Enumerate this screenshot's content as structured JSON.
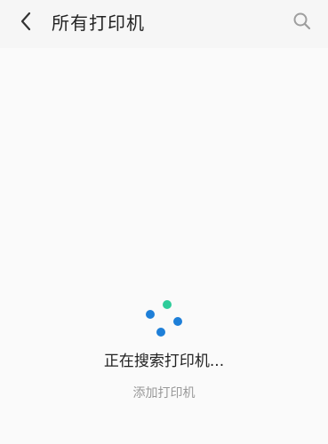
{
  "header": {
    "back_icon": "chevron-left-icon",
    "title": "所有打印机",
    "search_icon": "search-icon"
  },
  "main": {
    "status_text": "正在搜索打印机...",
    "add_printer_label": "添加打印机",
    "spinner": {
      "icon": "loading-spinner-icon",
      "dot_colors": [
        "#2ecc9a",
        "#1e7fd8",
        "#1e7fd8",
        "#1e7fd8"
      ]
    }
  },
  "colors": {
    "header_bg": "#f6f6f6",
    "page_bg": "#fafafa",
    "title_text": "#222222",
    "secondary_text": "#999999",
    "icon_gray": "#9e9e9e"
  }
}
